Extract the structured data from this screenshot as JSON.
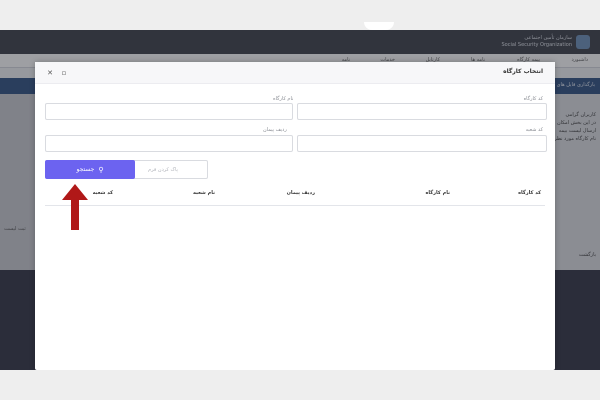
{
  "background": {
    "logo_title": "سازمان تأمین اجتماعی",
    "logo_subtitle": "Social Security Organization",
    "nav_items": [
      "داشبورد",
      "پیمه کارگاه",
      "نامه ها",
      "کارتابل",
      "خدمات",
      "نامه"
    ],
    "banner_text": "بارگذاری فایل های لیست",
    "side_lines": [
      "کاربران گرامی",
      "در این بخش امکان",
      "ارسال لیست بیمه",
      "نام کارگاه مورد نظر"
    ],
    "side_bottom": "ثبت لیست",
    "side_bottom2": "بازگشت"
  },
  "modal": {
    "title": "انتخاب کارگاه",
    "close_icon": "close-icon",
    "maximize_icon": "maximize-icon",
    "fields": {
      "workshop_code_label": "کد کارگاه",
      "workshop_name_label": "نام کارگاه",
      "branch_code_label": "کد شعبه",
      "contract_row_label": "ردیف پیمان",
      "workshop_code_value": "",
      "workshop_name_value": "",
      "branch_code_value": "",
      "contract_row_value": ""
    },
    "search_button": "جستجو",
    "search_icon": "search-icon",
    "clear_button": "پاک کردن فرم",
    "table_headers": [
      "کد کارگاه",
      "نام کارگاه",
      "ردیف پیمان",
      "نام شعبه",
      "کد شعبه"
    ]
  },
  "colors": {
    "primary": "#6c63f0",
    "header_dark": "#3a3d46",
    "banner": "#2c4f80",
    "arrow": "#b01818"
  }
}
